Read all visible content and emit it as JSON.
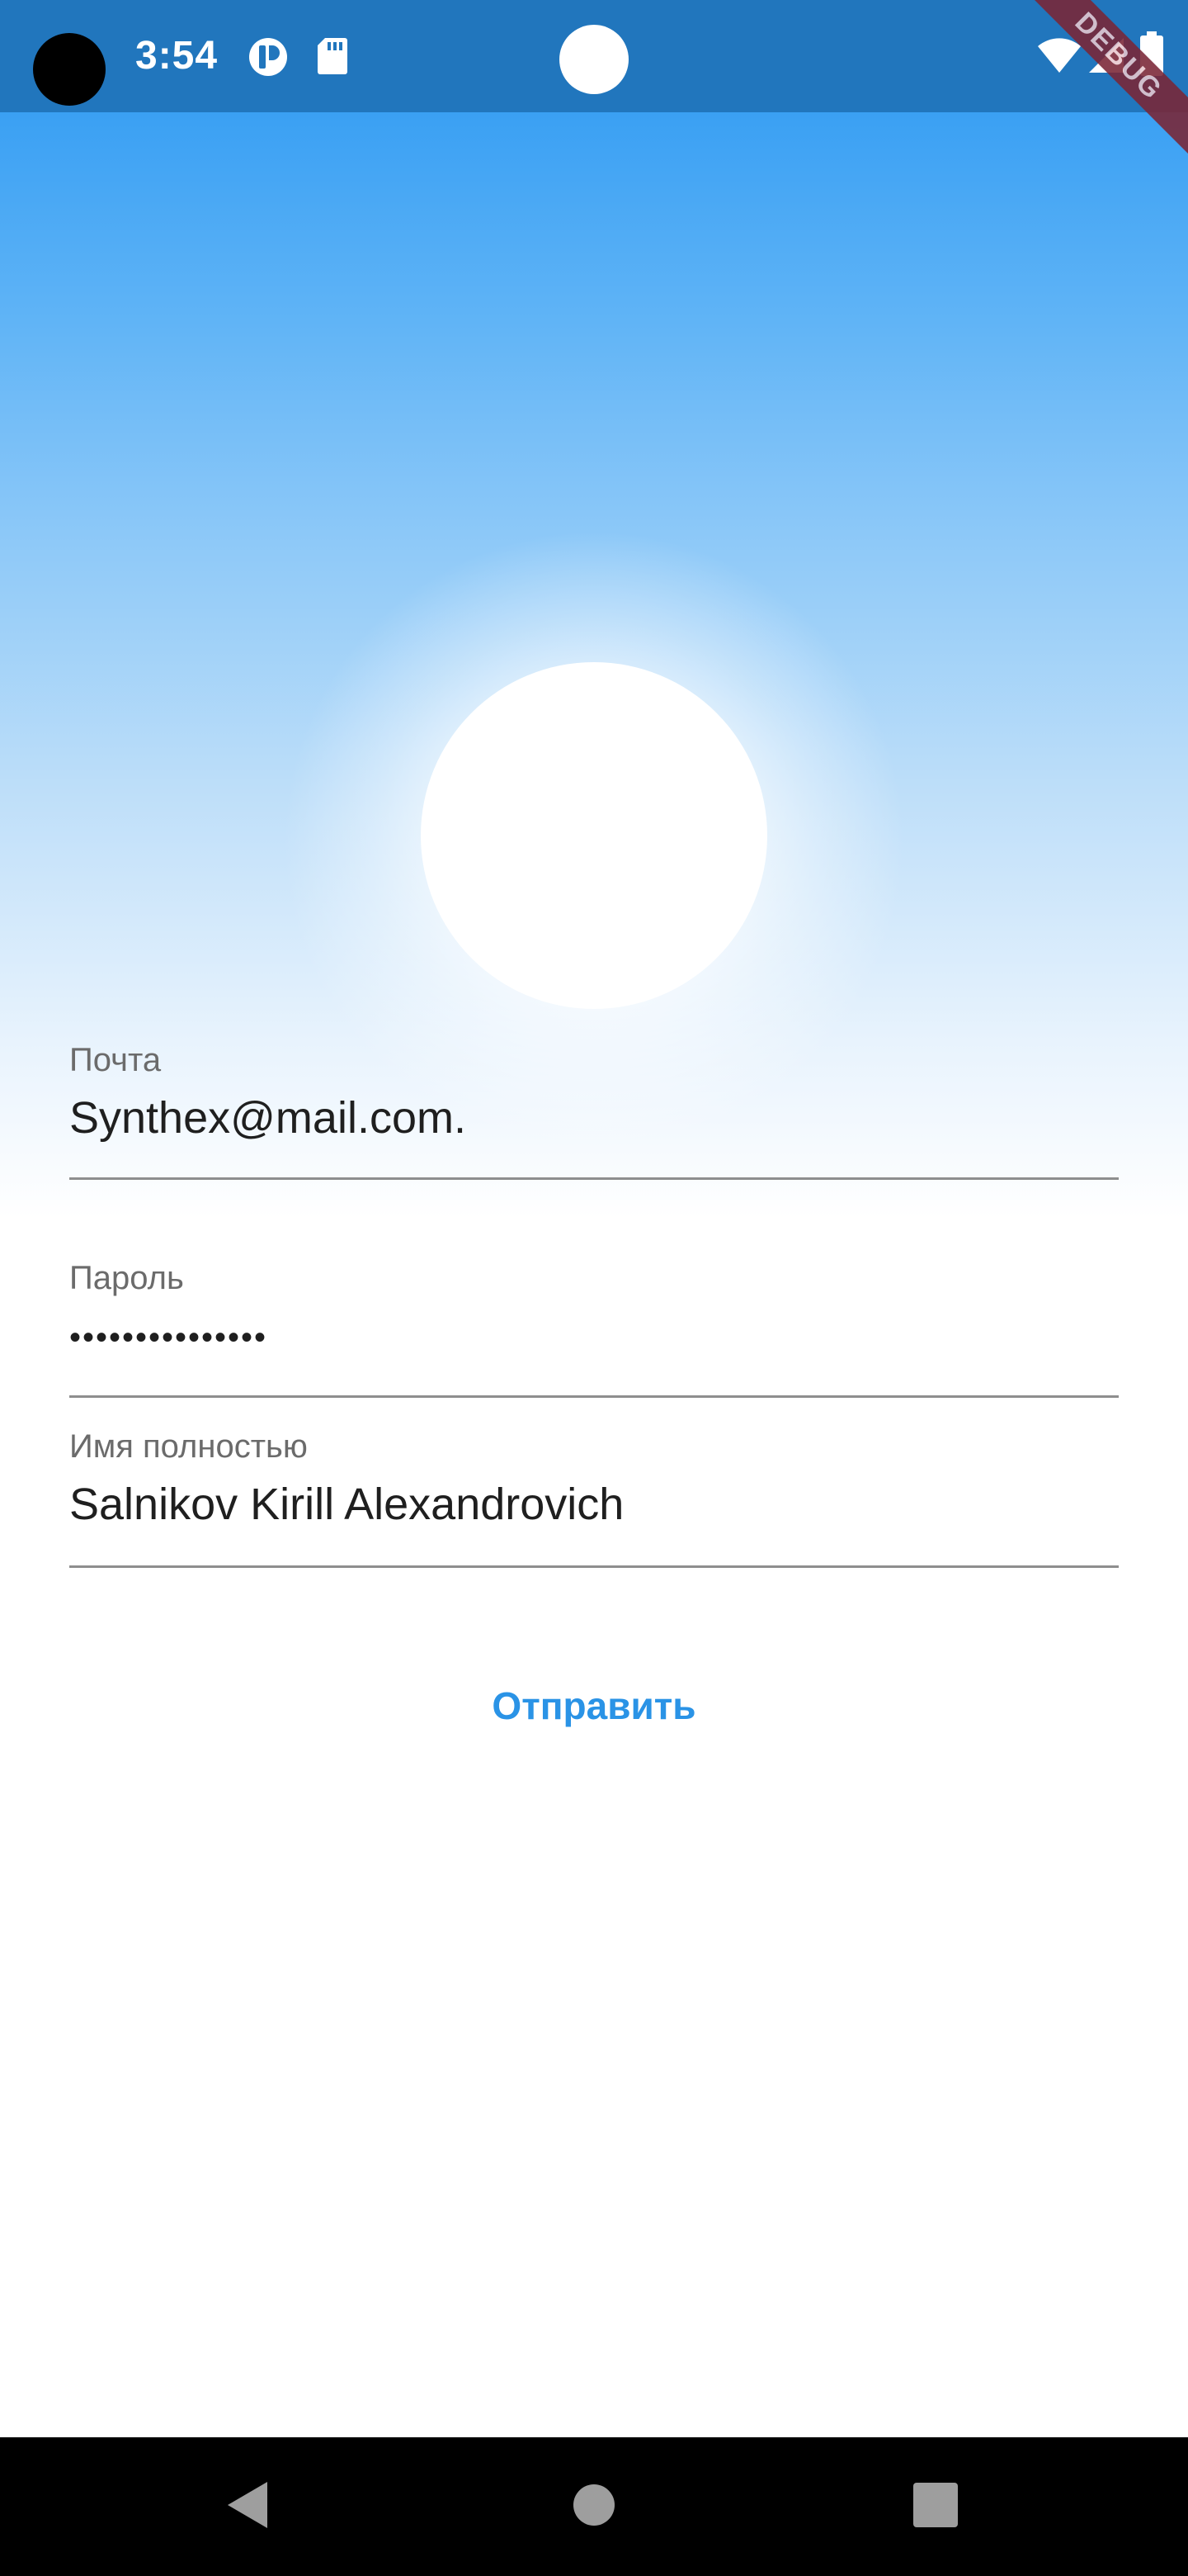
{
  "status_bar": {
    "time": "3:54",
    "icons": [
      "camera-cutout",
      "app-notification-icon",
      "sd-card-icon",
      "wifi-icon",
      "signal-icon",
      "battery-icon"
    ],
    "background_color": "#2176bd"
  },
  "debug_banner": {
    "label": "DEBUG",
    "color": "#7a2636"
  },
  "header": {
    "sky_top_color": "#3aa0f3",
    "sun_color": "#ffffff"
  },
  "form": {
    "email": {
      "label": "Почта",
      "value": "Synthex@mail.com."
    },
    "password": {
      "label": "Пароль",
      "value": "•••••••••••••••"
    },
    "full_name": {
      "label": "Имя полностью",
      "value": "Salnikov Kirill Alexandrovich"
    },
    "submit_label": "Отправить",
    "accent_color": "#2a93e6"
  },
  "nav_bar": {
    "buttons": [
      "back-icon",
      "home-icon",
      "recents-icon"
    ]
  }
}
